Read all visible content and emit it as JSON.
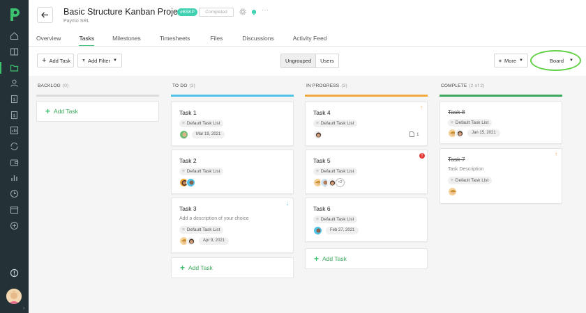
{
  "sidebar": {
    "items": [
      "home-icon",
      "book-icon",
      "folder-icon",
      "user-icon",
      "invoice-icon",
      "dollar-icon",
      "report-icon",
      "sync-icon",
      "wallet-icon",
      "bar-chart-icon",
      "clock-icon",
      "calendar-icon",
      "add-icon"
    ],
    "active": "folder-icon",
    "accent": "#3cc26f"
  },
  "project": {
    "title": "Basic Structure Kanban Project",
    "code": "#BSKP",
    "status": "Completed",
    "client": "Paymo SRL"
  },
  "tabs": [
    "Overview",
    "Tasks",
    "Milestones",
    "Timesheets",
    "Files",
    "Discussions",
    "Activity Feed"
  ],
  "active_tab": "Tasks",
  "toolbar": {
    "add_task": "Add Task",
    "add_filter": "Add Filter",
    "group_options": [
      "Ungrouped",
      "Users"
    ],
    "group_selected": "Ungrouped",
    "more": "More",
    "view": "Board"
  },
  "board": {
    "add_task_label": "Add Task",
    "columns": [
      {
        "name": "BACKLOG",
        "count": "(0)",
        "color": "#dcdcdc",
        "tasks": []
      },
      {
        "name": "TO DO",
        "count": "(3)",
        "color": "#4fc3e8",
        "tasks": [
          {
            "title": "Task 1",
            "list": "Default Task List",
            "date": "Mar 19, 2021"
          },
          {
            "title": "Task 2",
            "list": "Default Task List"
          },
          {
            "title": "Task 3",
            "desc": "Add a description of your choice",
            "list": "Default Task List",
            "date": "Apr 9, 2021"
          }
        ]
      },
      {
        "name": "IN PROGRESS",
        "count": "(3)",
        "color": "#f4a93c",
        "tasks": [
          {
            "title": "Task 4",
            "list": "Default Task List",
            "files": "1"
          },
          {
            "title": "Task 5",
            "list": "Default Task List",
            "more_users": "+2"
          },
          {
            "title": "Task 6",
            "list": "Default Task List",
            "date": "Feb 27, 2021"
          }
        ]
      },
      {
        "name": "COMPLETE",
        "count": "(2 of 2)",
        "color": "#3aa85a",
        "tasks": [
          {
            "title": "Task 8",
            "list": "Default Task List",
            "date": "Jan 15, 2021"
          },
          {
            "title": "Task 7",
            "desc": "Task Description",
            "list": "Default Task List"
          }
        ]
      }
    ]
  }
}
